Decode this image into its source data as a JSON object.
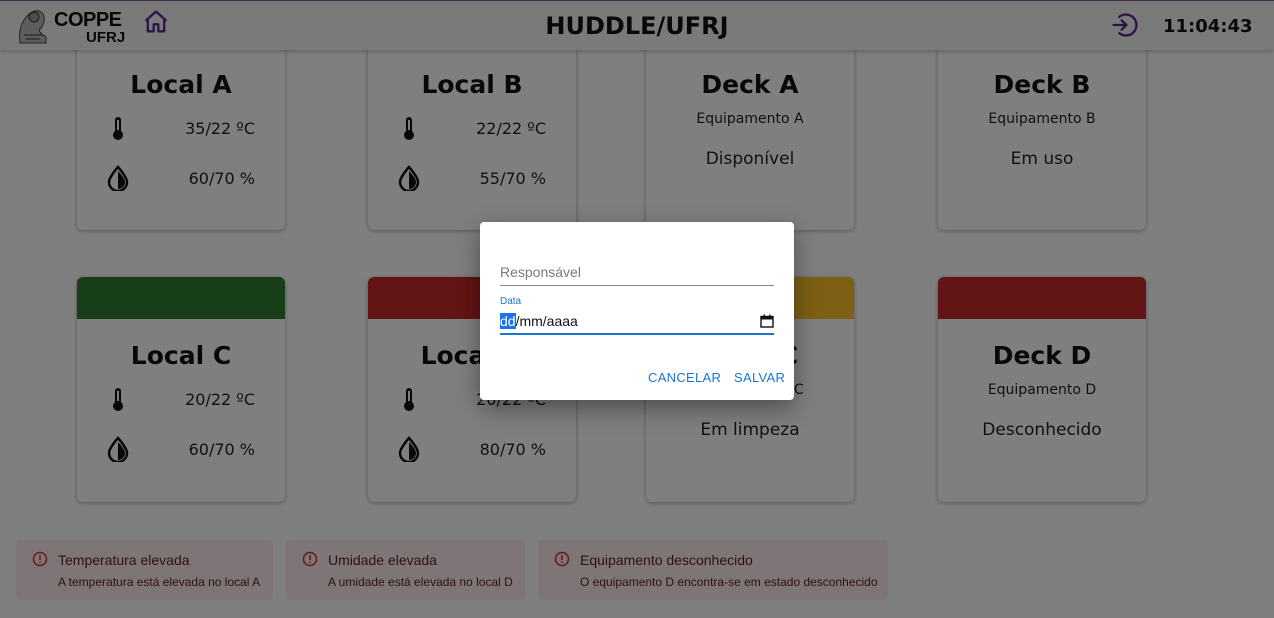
{
  "header": {
    "logo_line1": "COPPE",
    "logo_line2": "UFRJ",
    "title": "HUDDLE/UFRJ",
    "clock": "11:04:43",
    "home_icon": "home-icon",
    "logout_icon": "logout-icon"
  },
  "cards": [
    {
      "title": "Local A",
      "temp": "35/22 ºC",
      "humidity": "60/70 %",
      "status_color": null
    },
    {
      "title": "Local B",
      "temp": "22/22 ºC",
      "humidity": "55/70 %",
      "status_color": null
    },
    {
      "title": "Deck A",
      "equipment": "Equipamento A",
      "status": "Disponível",
      "status_color": null
    },
    {
      "title": "Deck B",
      "equipment": "Equipamento B",
      "status": "Em uso",
      "status_color": null
    },
    {
      "title": "Local C",
      "temp": "20/22 ºC",
      "humidity": "60/70 %",
      "status_color": "#2e7d32"
    },
    {
      "title": "Local D",
      "temp": "20/22 ºC",
      "humidity": "80/70 %",
      "status_color": "#c62828"
    },
    {
      "title": "Deck C",
      "equipment": "Equipamento C",
      "status": "Em limpeza",
      "status_color": "#fbc02d"
    },
    {
      "title": "Deck D",
      "equipment": "Equipamento D",
      "status": "Desconhecido",
      "status_color": "#c62828"
    }
  ],
  "alerts": [
    {
      "title": "Temperatura elevada",
      "message": "A temperatura está elevada no local A"
    },
    {
      "title": "Umidade elevada",
      "message": "A umidade está elevada no local D"
    },
    {
      "title": "Equipamento desconhecido",
      "message": "O equipamento D encontra-se em estado desconhecido"
    }
  ],
  "dialog": {
    "responsible_placeholder": "Responsável",
    "date_label": "Data",
    "date_day": "dd",
    "date_rest": "/mm/aaaa",
    "cancel_label": "CANCELAR",
    "save_label": "SALVAR"
  },
  "colors": {
    "overlay": "rgba(0,0,0,0.5)",
    "accent": "#1976d2",
    "alert_bg": "#fdeded",
    "alert_text": "#5f2120",
    "header_icons": "#5b2a86"
  }
}
